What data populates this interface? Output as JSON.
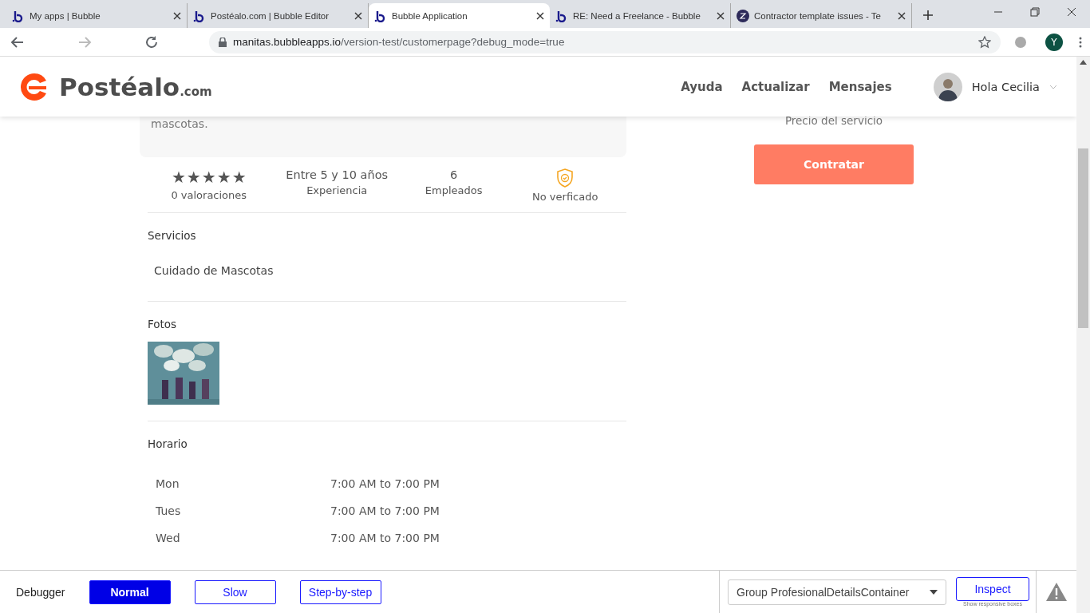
{
  "browser": {
    "tabs": [
      {
        "title": "My apps | Bubble",
        "selected": false
      },
      {
        "title": "Postéalo.com | Bubble Editor",
        "selected": false
      },
      {
        "title": "Bubble Application",
        "selected": true
      },
      {
        "title": "RE: Need a Freelance - Bubble",
        "selected": false
      },
      {
        "title": "Contractor template issues - Te",
        "selected": false
      }
    ],
    "url_host": "manitas.bubbleapps.io",
    "url_path": "/version-test/customerpage?debug_mode=true",
    "profile": "Y"
  },
  "header": {
    "logo": "Postéalo",
    "logo_suffix": ".com",
    "nav": [
      "Ayuda",
      "Actualizar",
      "Mensajes"
    ],
    "user": "Hola Cecilia"
  },
  "description_tail": "mascotas.",
  "stats": {
    "stars": 5,
    "reviews": "0 valoraciones",
    "experience_value": "Entre 5 y 10 años",
    "experience_label": "Experiencia",
    "employees_value": "6",
    "employees_label": "Empleados",
    "verification": "No verficado"
  },
  "services": {
    "title": "Servicios",
    "items": [
      "Cuidado de Mascotas"
    ]
  },
  "photos": {
    "title": "Fotos"
  },
  "schedule": {
    "title": "Horario",
    "rows": [
      {
        "day": "Mon",
        "hours": "7:00 AM to 7:00 PM"
      },
      {
        "day": "Tues",
        "hours": "7:00 AM to 7:00 PM"
      },
      {
        "day": "Wed",
        "hours": "7:00 AM to 7:00 PM"
      }
    ]
  },
  "price_label": "Precio del servicio",
  "hire_button": "Contratar",
  "debugger": {
    "label": "Debugger",
    "modes": [
      {
        "label": "Normal",
        "selected": true
      },
      {
        "label": "Slow",
        "selected": false
      },
      {
        "label": "Step-by-step",
        "selected": false
      }
    ],
    "element": "Group ProfesionalDetailsContainer",
    "inspect": "Inspect",
    "inspect_hint": "Show responsive boxes"
  }
}
